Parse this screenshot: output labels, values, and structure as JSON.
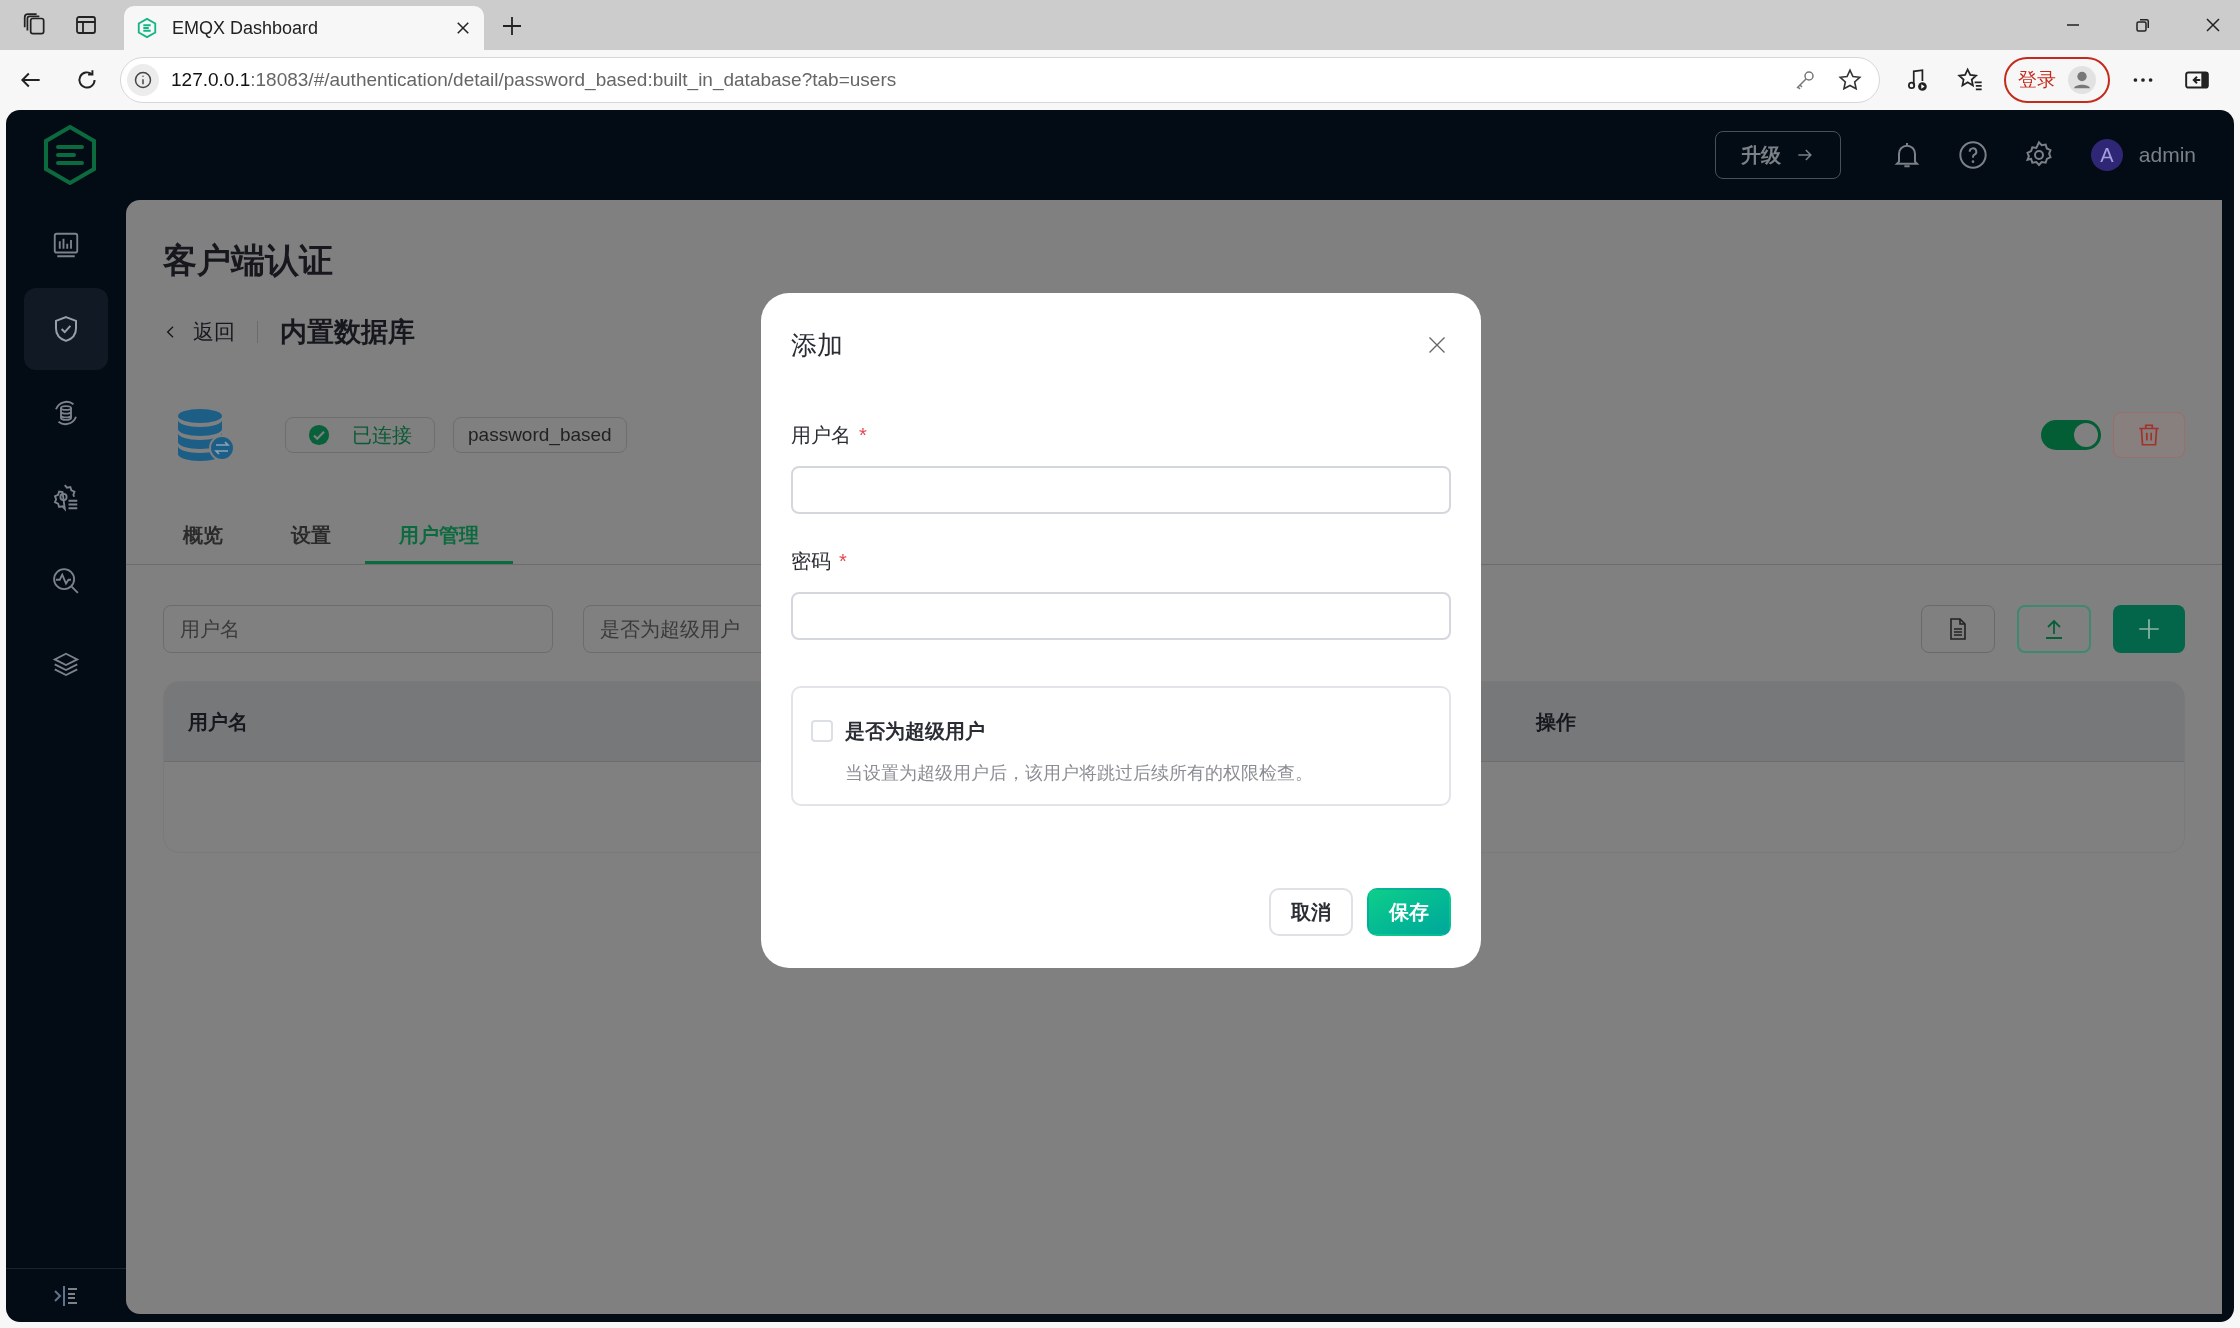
{
  "browser": {
    "tab_title": "EMQX Dashboard",
    "url_host": "127.0.0.1",
    "url_rest": ":18083/#/authentication/detail/password_based:built_in_database?tab=users",
    "login_button": "登录"
  },
  "header": {
    "upgrade_button": "升级",
    "avatar_letter": "A",
    "user": "admin"
  },
  "sidebar": {
    "items": [
      {
        "kind": "dashboard",
        "selected": false
      },
      {
        "kind": "shield",
        "selected": true
      },
      {
        "kind": "integration",
        "selected": false
      },
      {
        "kind": "management",
        "selected": false
      },
      {
        "kind": "diagnose",
        "selected": false
      },
      {
        "kind": "layers",
        "selected": false
      }
    ]
  },
  "page": {
    "title": "客户端认证",
    "back": "返回",
    "subtitle": "内置数据库",
    "status_badge": "已连接",
    "type_badge": "password_based",
    "enabled": true
  },
  "tabs": [
    {
      "label": "概览",
      "selected": false
    },
    {
      "label": "设置",
      "selected": false
    },
    {
      "label": "用户管理",
      "selected": true
    }
  ],
  "filters": [
    {
      "placeholder": "用户名"
    },
    {
      "placeholder": "是否为超级用户"
    }
  ],
  "table": {
    "columns": [
      "用户名",
      "操作"
    ]
  },
  "dialog": {
    "title": "添加",
    "fields": [
      {
        "label": "用户名",
        "required_mark": "*"
      },
      {
        "label": "密码",
        "required_mark": "*"
      }
    ],
    "superuser": {
      "label": "是否为超级用户",
      "checked": false,
      "description": "当设置为超级用户后，该用户将跳过后续所有的权限检查。"
    },
    "buttons": [
      {
        "label": "取消",
        "kind": "default"
      },
      {
        "label": "保存",
        "kind": "primary"
      }
    ]
  }
}
